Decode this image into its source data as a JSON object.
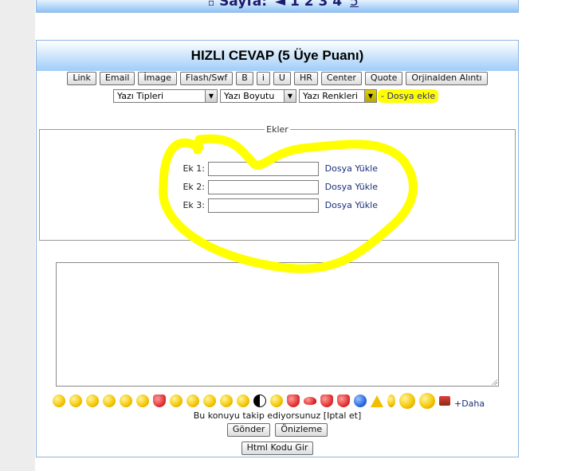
{
  "top": {
    "label": "Sayfa:",
    "arrow": "◄",
    "pages": [
      "1",
      "2",
      "3",
      "4"
    ],
    "current_page": "5"
  },
  "form": {
    "title": "HIZLI CEVAP (5 Üye Puanı)",
    "toolbar_buttons": [
      "Link",
      "Email",
      "İmage",
      "Flash/Swf",
      "B",
      "i",
      "U",
      "HR",
      "Center",
      "Quote",
      "Orjinalden Alıntı"
    ],
    "selects": {
      "font": "Yazı Tipleri",
      "size": "Yazı Boyutu",
      "color": "Yazı Renkleri"
    },
    "add_file": "- Dosya ekle",
    "attachments": {
      "legend": "Ekler",
      "rows": [
        {
          "label": "Ek 1:",
          "value": "",
          "link": "Dosya Yükle"
        },
        {
          "label": "Ek 2:",
          "value": "",
          "link": "Dosya Yükle"
        },
        {
          "label": "Ek 3:",
          "value": "",
          "link": "Dosya Yükle"
        }
      ]
    },
    "message": "",
    "more_smileys": "+Daha",
    "follow_text": "Bu konuyu takip ediyorsunuz [Iptal et]",
    "send_button": "Gönder",
    "preview_button": "Önizleme",
    "html_button": "Html Kodu Gir"
  },
  "colors": {
    "highlight": "#ffff00",
    "header_gradient_bottom": "#9fcdf7",
    "border": "#8fb5e0",
    "link": "#1c2f7a"
  }
}
